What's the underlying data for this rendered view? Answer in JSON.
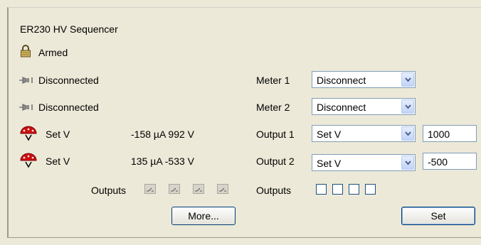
{
  "panel": {
    "title": "ER230 HV Sequencer"
  },
  "status": {
    "icon": "padlock-icon",
    "label": "Armed"
  },
  "meters": [
    {
      "icon": "plug-icon",
      "status": "Disconnected",
      "label": "Meter 1",
      "mode": "Disconnect"
    },
    {
      "icon": "plug-icon",
      "status": "Disconnected",
      "label": "Meter 2",
      "mode": "Disconnect"
    }
  ],
  "outputs": [
    {
      "icon": "hv-dome-icon",
      "status": "Set V",
      "reading": "-158 µA 992 V",
      "label": "Output 1",
      "mode": "Set V",
      "value": "1000"
    },
    {
      "icon": "hv-dome-icon",
      "status": "Set V",
      "reading": "135 µA -533 V",
      "label": "Output 2",
      "mode": "Set V",
      "value": "-500"
    }
  ],
  "outputs_row": {
    "left_label": "Outputs",
    "right_label": "Outputs",
    "leds": [
      "off",
      "off",
      "off",
      "off"
    ],
    "checkboxes": [
      false,
      false,
      false,
      false
    ]
  },
  "buttons": {
    "more": "More...",
    "set": "Set"
  },
  "colors": {
    "background": "#ece9d8",
    "dome_red": "#cc1010",
    "input_border": "#7f9db9"
  }
}
